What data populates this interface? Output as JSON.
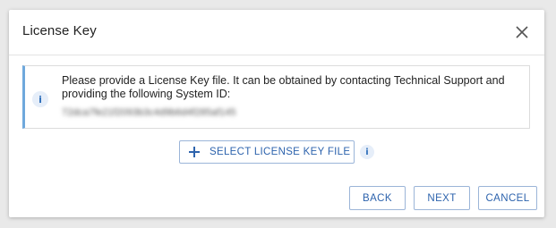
{
  "dialog": {
    "title": "License Key",
    "close_icon": "close-icon"
  },
  "info": {
    "icon": "info-icon",
    "icon_glyph": "i",
    "message": "Please provide a License Key file. It can be obtained by contacting Technical Support and providing the following System ID:",
    "system_id": "72dca7fe21f2093b3c4d9b6d4f285af145"
  },
  "actions": {
    "select_label": "SELECT LICENSE KEY FILE",
    "select_icon": "plus-icon",
    "help_icon": "info-icon",
    "help_glyph": "i"
  },
  "footer": {
    "back_label": "BACK",
    "next_label": "NEXT",
    "cancel_label": "CANCEL"
  },
  "colors": {
    "accent": "#2d63ad",
    "info_border": "#6fa8dc"
  }
}
